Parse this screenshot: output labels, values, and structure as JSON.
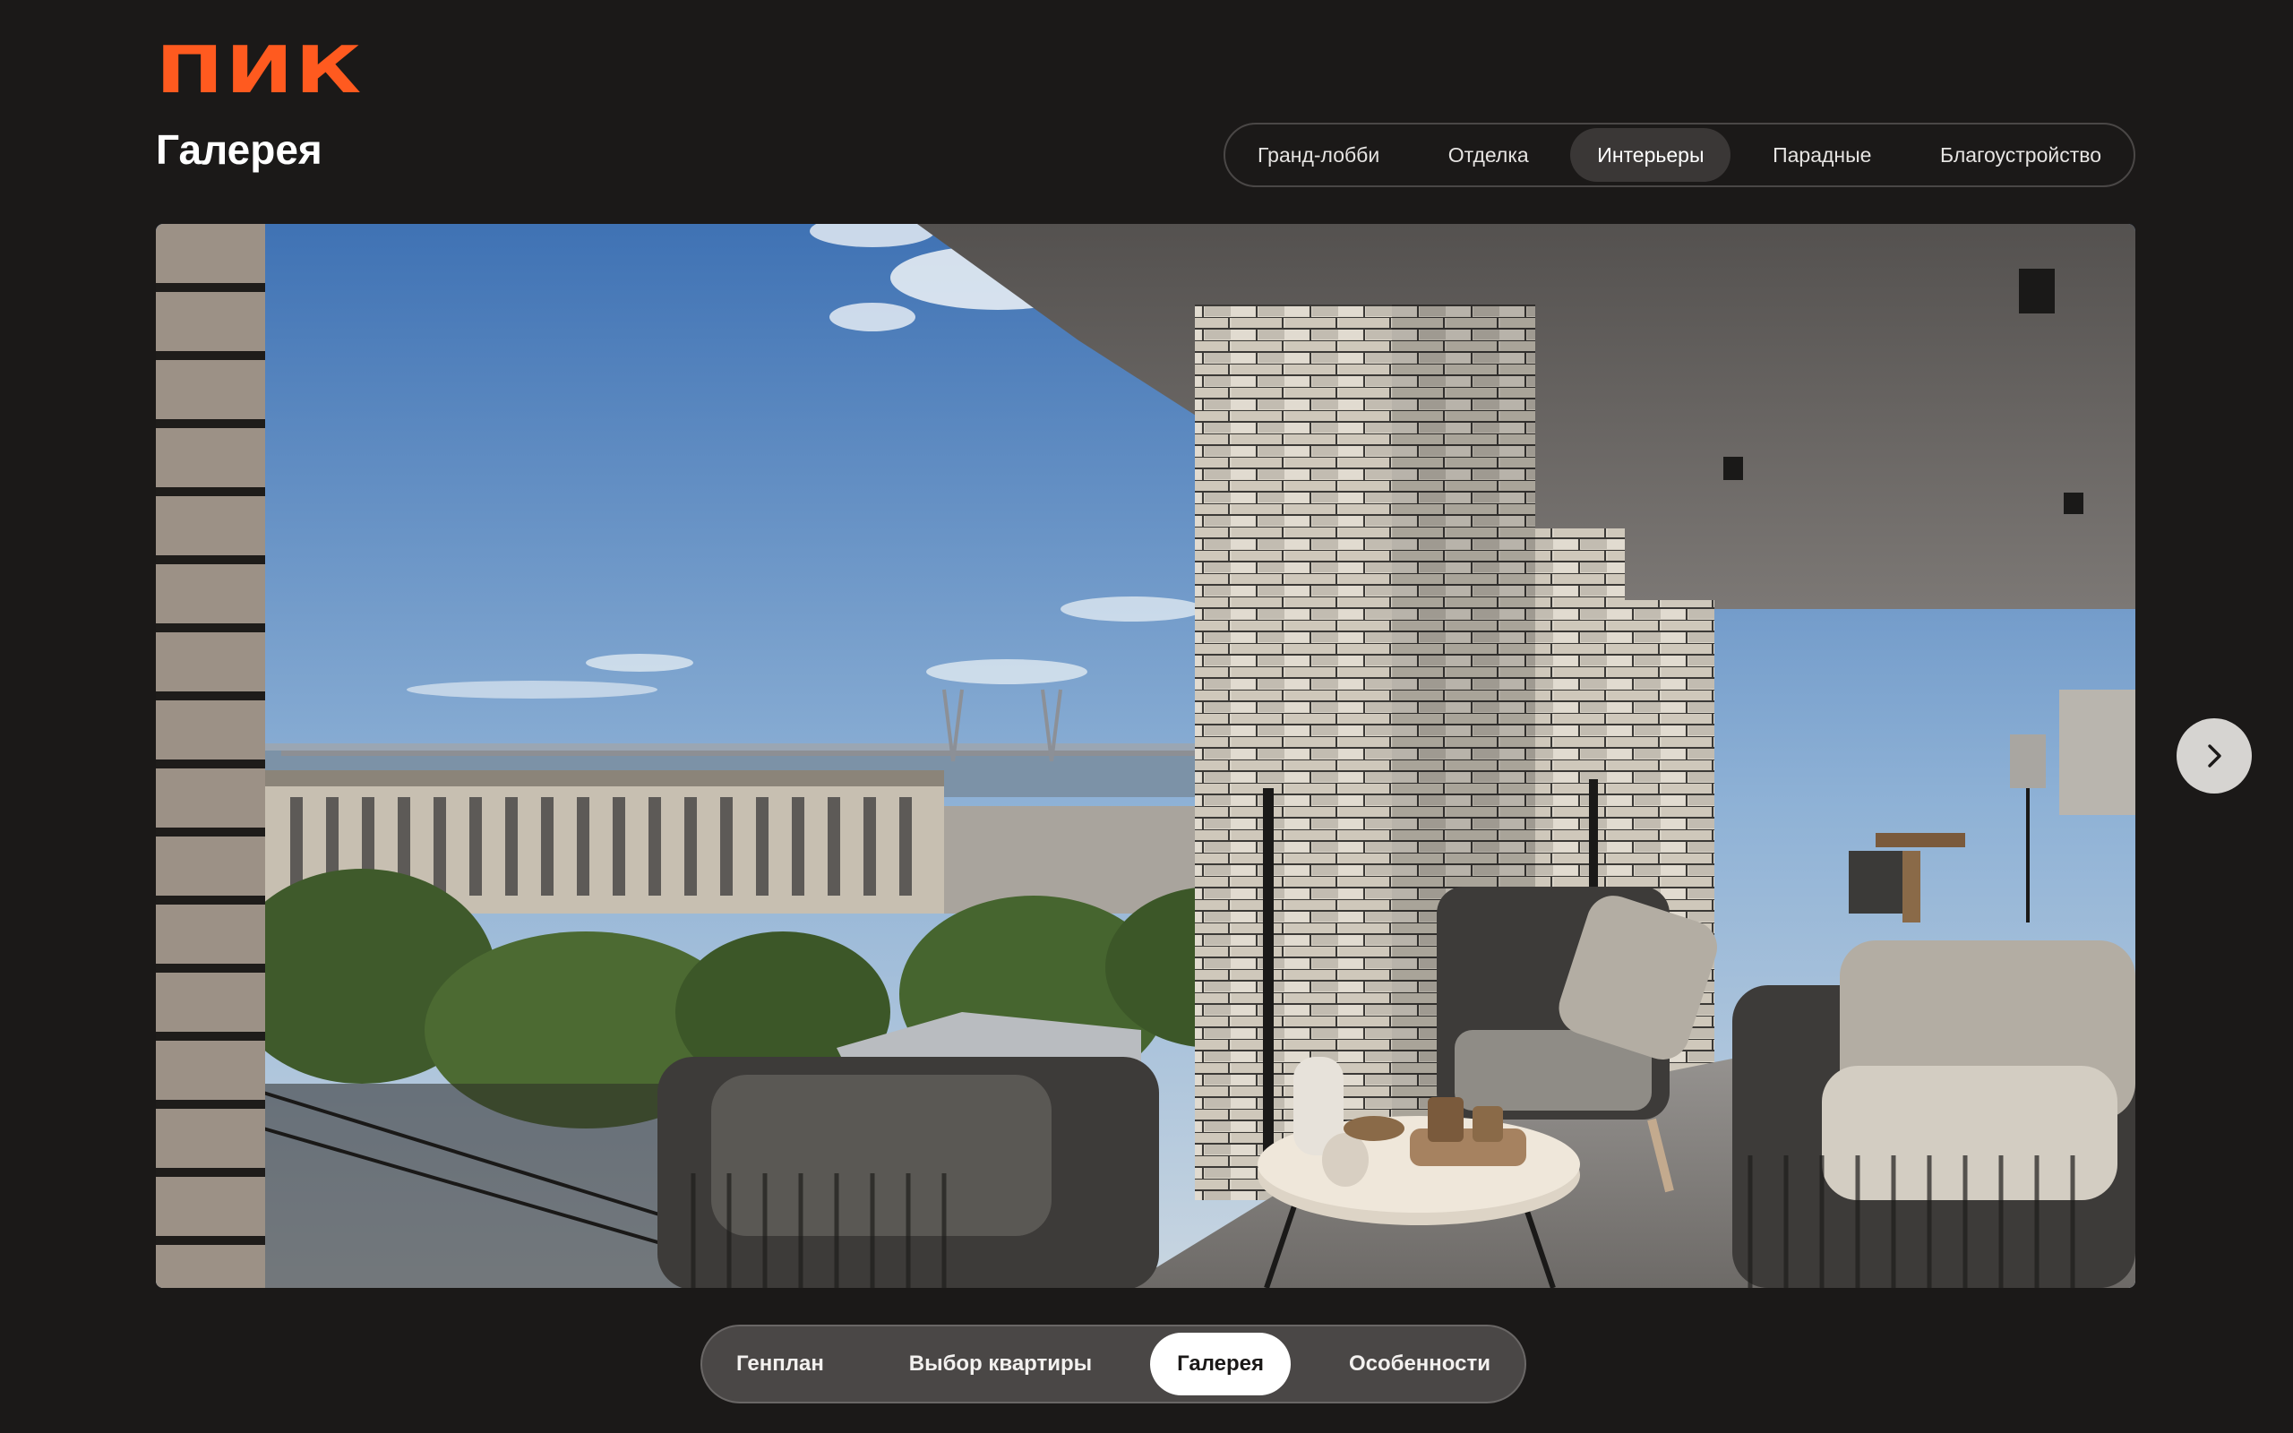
{
  "brand": {
    "logo_text": "ПИК",
    "accent": "#ff5a1f"
  },
  "page": {
    "title": "Галерея"
  },
  "category_tabs": [
    {
      "label": "Гранд-лобби",
      "active": false
    },
    {
      "label": "Отделка",
      "active": false
    },
    {
      "label": "Интерьеры",
      "active": true
    },
    {
      "label": "Парадные",
      "active": false
    },
    {
      "label": "Благоустройство",
      "active": false
    }
  ],
  "gallery": {
    "next_icon": "chevron-right-icon"
  },
  "bottom_nav": [
    {
      "label": "Генплан",
      "active": false
    },
    {
      "label": "Выбор квартиры",
      "active": false
    },
    {
      "label": "Галерея",
      "active": true
    },
    {
      "label": "Особенности",
      "active": false
    }
  ]
}
